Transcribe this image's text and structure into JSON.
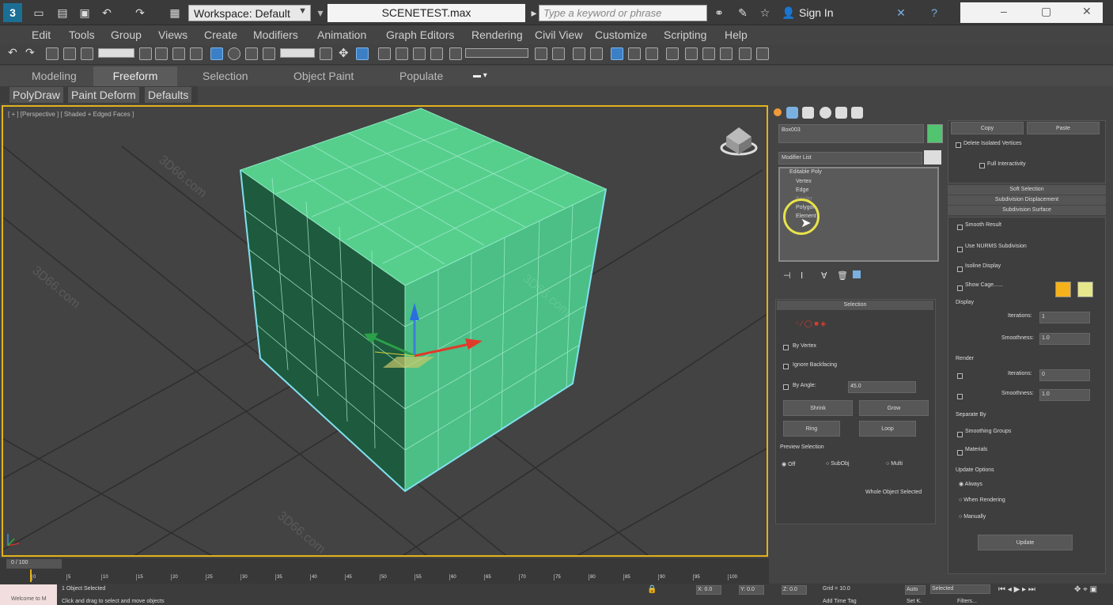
{
  "title_bar": {
    "logo": "3",
    "workspace": "Workspace: Default",
    "file_title": "SCENETEST.max",
    "search_placeholder": "Type a keyword or phrase",
    "sign_in": "Sign In"
  },
  "menu": [
    "Edit",
    "Tools",
    "Group",
    "Views",
    "Create",
    "Modifiers",
    "Animation",
    "Graph Editors",
    "Rendering",
    "Civil View",
    "Customize",
    "Scripting",
    "Help"
  ],
  "ribbon": {
    "tabs": [
      "Modeling",
      "Freeform",
      "Selection",
      "Object Paint",
      "Populate"
    ],
    "active": "Freeform",
    "subtabs": [
      "PolyDraw",
      "Paint Deform",
      "Defaults"
    ]
  },
  "viewport": {
    "label": "[ + ] [Perspective ] [ Shaded + Edged Faces ]",
    "watermark": "3D66.com"
  },
  "command_panel": {
    "object_name": "Box003",
    "modifier_list": "Modifier List",
    "stack": [
      "Editable Poly",
      "Vertex",
      "Edge",
      "Border",
      "Polygon",
      "Element"
    ],
    "selection": {
      "header": "Selection",
      "by_vertex": "By Vertex",
      "ignore_backfacing": "Ignore Backfacing",
      "by_angle": "By Angle:",
      "angle_value": "45.0",
      "shrink": "Shrink",
      "grow": "Grow",
      "ring": "Ring",
      "loop": "Loop",
      "preview_selection": "Preview Selection",
      "preview_opts": [
        "Off",
        "SubObj",
        "Multi"
      ],
      "status": "Whole Object Selected"
    },
    "right": {
      "copy": "Copy",
      "paste": "Paste",
      "delete_isolated": "Delete Isolated Vertices",
      "full_interactivity": "Full Interactivity",
      "soft_selection": "Soft Selection",
      "subdivision_displacement": "Subdivision Displacement",
      "subdivision_surface": "Subdivision Surface",
      "smooth_result": "Smooth Result",
      "use_nurms": "Use NURMS Subdivision",
      "isoline_display": "Isoline Display",
      "show_cage": "Show Cage......",
      "display": "Display",
      "iterations": "Iterations:",
      "iterations_val": "1",
      "smoothness": "Smoothness:",
      "smoothness_val": "1.0",
      "render": "Render",
      "r_iterations_val": "0",
      "r_smoothness_val": "1.0",
      "separate_by": "Separate By",
      "smoothing_groups": "Smoothing Groups",
      "materials": "Materials",
      "update_options": "Update Options",
      "always": "Always",
      "when_rendering": "When Rendering",
      "manually": "Manually",
      "update": "Update"
    }
  },
  "timeline": {
    "frame": "0 / 100",
    "ticks": [
      "0",
      "5",
      "10",
      "15",
      "20",
      "25",
      "30",
      "35",
      "40",
      "45",
      "50",
      "55",
      "60",
      "65",
      "70",
      "75",
      "80",
      "85",
      "90",
      "95",
      "100"
    ]
  },
  "status": {
    "selected": "1 Object Selected",
    "hint": "Click and drag to select and move objects",
    "maxscript": "Welcome to M",
    "x": "X: 0.0",
    "y": "Y: 0.0",
    "z": "Z: 0.0",
    "grid": "Grid = 10.0",
    "auto": "Auto",
    "selected_dd": "Selected",
    "set_key": "Set K.",
    "filters": "Filters...",
    "add_time_tag": "Add Time Tag"
  },
  "colors": {
    "accent": "#e2b21a",
    "cube": "#4fc98a",
    "obj_color": "#52c46f",
    "cage1": "#f5b21a",
    "cage2": "#e6e68c"
  }
}
